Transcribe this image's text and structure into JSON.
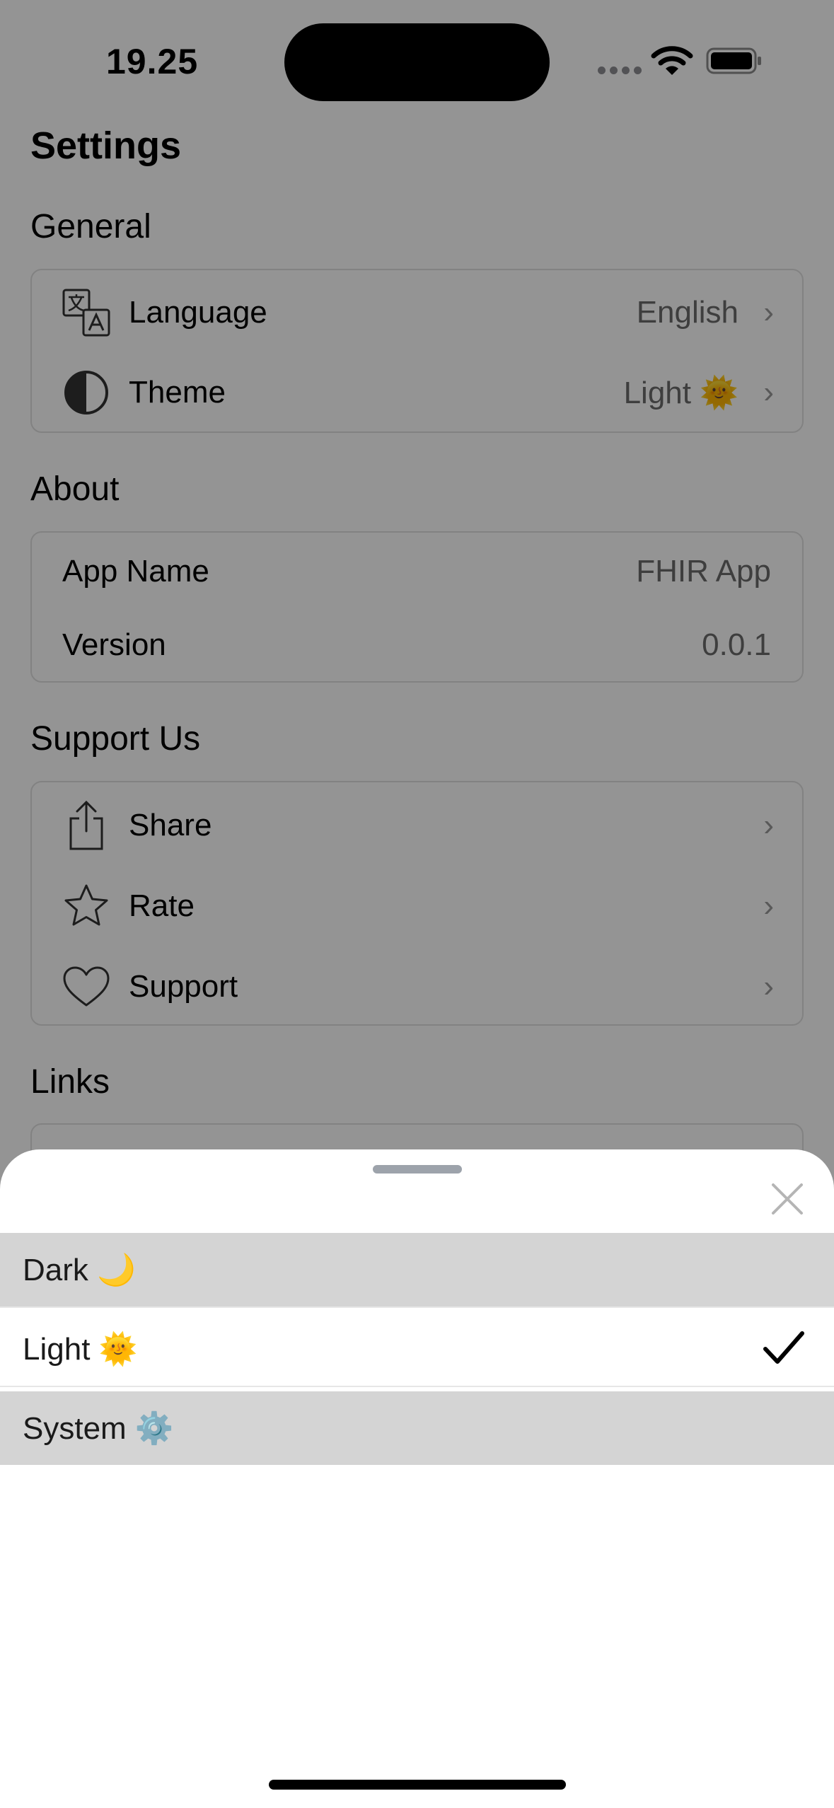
{
  "status_bar": {
    "time": "19.25"
  },
  "page_title": "Settings",
  "sections": {
    "general": {
      "title": "General",
      "language": {
        "label": "Language",
        "value": "English"
      },
      "theme": {
        "label": "Theme",
        "value": "Light 🌞"
      }
    },
    "about": {
      "title": "About",
      "app_name": {
        "label": "App Name",
        "value": "FHIR App"
      },
      "version": {
        "label": "Version",
        "value": "0.0.1"
      }
    },
    "support": {
      "title": "Support Us",
      "share": {
        "label": "Share"
      },
      "rate": {
        "label": "Rate"
      },
      "support": {
        "label": "Support"
      }
    },
    "links": {
      "title": "Links"
    }
  },
  "theme_sheet": {
    "options": [
      {
        "label": "Dark 🌙",
        "selected": false
      },
      {
        "label": "Light 🌞",
        "selected": true
      },
      {
        "label": "System ⚙️",
        "selected": false
      }
    ]
  },
  "icons": {
    "language": "translate-icon",
    "theme": "contrast-icon",
    "share": "share-icon",
    "rate": "star-icon",
    "support": "heart-icon",
    "close": "close-icon",
    "selected": "checkmark-icon"
  },
  "colors": {
    "overlay": "#000000",
    "sheet_background": "#ffffff",
    "unselected_option_background": "#d4d4d4",
    "secondary_text": "#6b6b6b"
  }
}
